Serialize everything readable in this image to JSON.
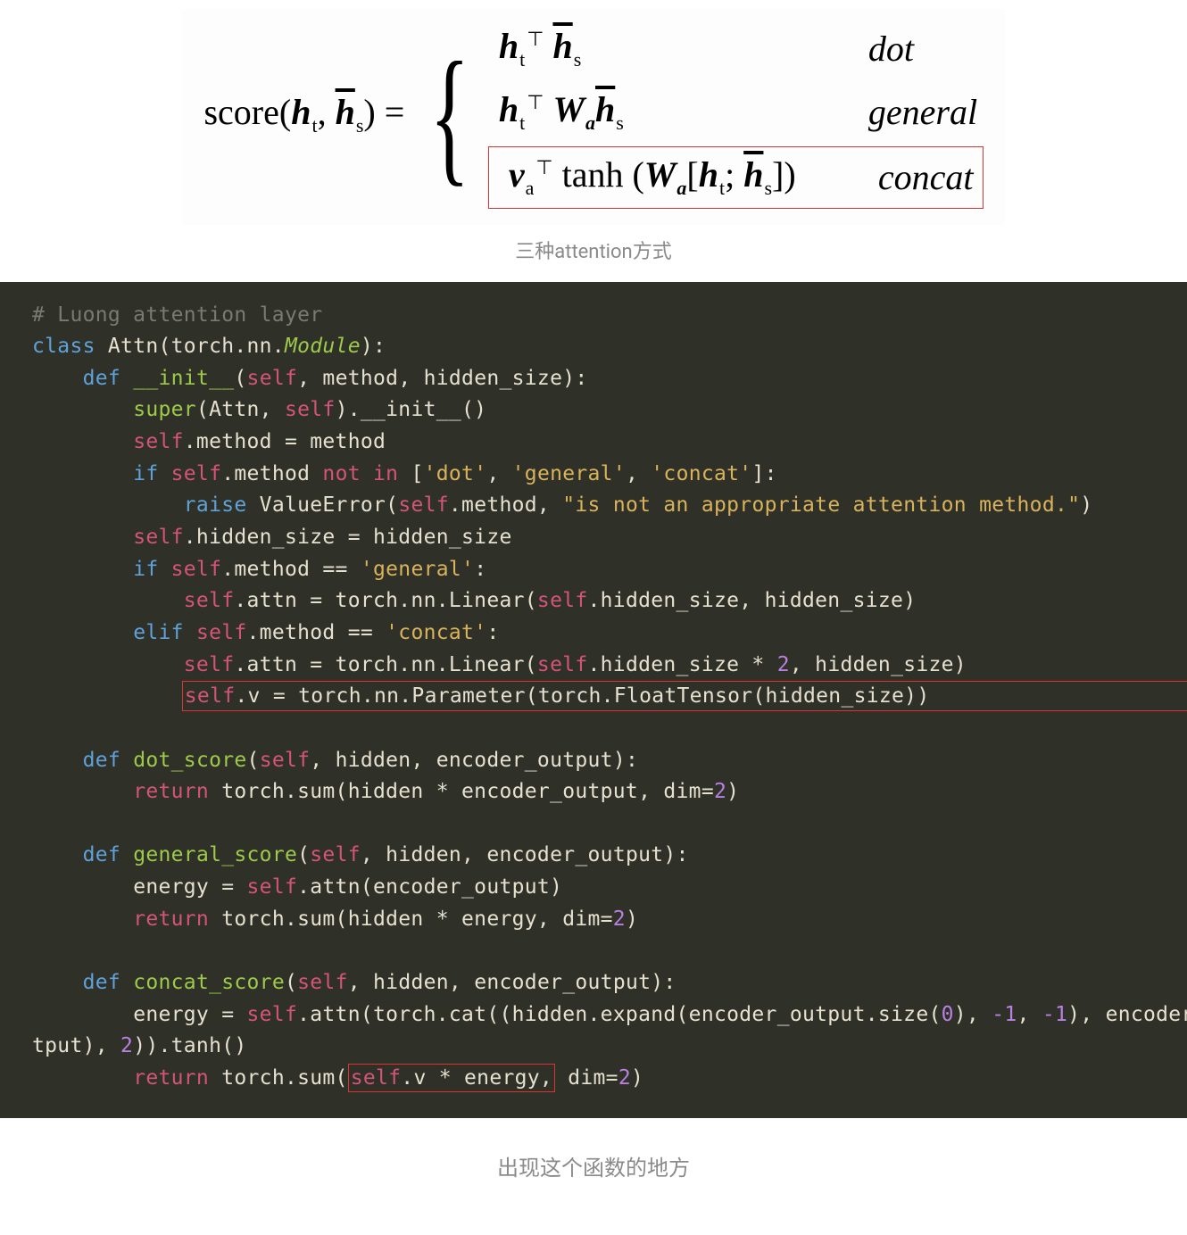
{
  "formula": {
    "lhs": "score(h_t, h̄_s) =",
    "cases": [
      {
        "expr": "h_t^T h̄_s",
        "label": "dot"
      },
      {
        "expr": "h_t^T W_a h̄_s",
        "label": "general"
      },
      {
        "expr": "v_a^T tanh(W_a [h_t; h̄_s])",
        "label": "concat"
      }
    ]
  },
  "caption_formula": "三种attention方式",
  "code": {
    "l1": "# Luong attention layer",
    "l2a": "class",
    "l2b": " Attn(torch.nn.",
    "l2c": "Module",
    "l2d": "):",
    "l3a": "def",
    "l3b": "__init__",
    "l3c": "self",
    "l3d": ", method, hidden_size):",
    "l4a": "super",
    "l4b": "(Attn, ",
    "l4c": "self",
    "l4d": ").__init__()",
    "l5a": "self",
    "l5b": ".method = method",
    "l6a": "if",
    "l6b": "self",
    "l6c": ".method ",
    "l6d": "not in",
    "l6e": " [",
    "l6f": "'dot'",
    "l6g": ", ",
    "l6h": "'general'",
    "l6i": ", ",
    "l6j": "'concat'",
    "l6k": "]:",
    "l7a": "raise",
    "l7b": " ValueError(",
    "l7c": "self",
    "l7d": ".method, ",
    "l7e": "\"is not an appropriate attention method.\"",
    "l7f": ")",
    "l8a": "self",
    "l8b": ".hidden_size = hidden_size",
    "l9a": "if",
    "l9b": "self",
    "l9c": ".method == ",
    "l9d": "'general'",
    "l9e": ":",
    "l10a": "self",
    "l10b": ".attn = torch.nn.Linear(",
    "l10c": "self",
    "l10d": ".hidden_size, hidden_size)",
    "l11a": "elif",
    "l11b": "self",
    "l11c": ".method == ",
    "l11d": "'concat'",
    "l11e": ":",
    "l12a": "self",
    "l12b": ".attn = torch.nn.Linear(",
    "l12c": "self",
    "l12d": ".hidden_size * ",
    "l12e": "2",
    "l12f": ", hidden_size)",
    "l13a": "self",
    "l13b": ".v = torch.nn.Parameter(torch.FloatTensor(hidden_size))",
    "l14a": "def",
    "l14b": "dot_score",
    "l14c": "self",
    "l14d": ", hidden, encoder_output):",
    "l15a": "return",
    "l15b": " torch.sum(hidden * encoder_output, dim=",
    "l15c": "2",
    "l15d": ")",
    "l16a": "def",
    "l16b": "general_score",
    "l16c": "self",
    "l16d": ", hidden, encoder_output):",
    "l17a": "energy = ",
    "l17b": "self",
    "l17c": ".attn(encoder_output)",
    "l18a": "return",
    "l18b": " torch.sum(hidden * energy, dim=",
    "l18c": "2",
    "l18d": ")",
    "l19a": "def",
    "l19b": "concat_score",
    "l19c": "self",
    "l19d": ", hidden, encoder_output):",
    "l20a": "energy = ",
    "l20b": "self",
    "l20c": ".attn(torch.cat((hidden.expand(encoder_output.size(",
    "l20d": "0",
    "l20e": "), ",
    "l20f": "-1",
    "l20g": ", ",
    "l20h": "-1",
    "l20i": "), encoder_o",
    "l20j": "tput), ",
    "l20k": "2",
    "l20l": ")).tanh()",
    "l21a": "return",
    "l21b": " torch.sum(",
    "l21c": "self",
    "l21d": ".v * energy,",
    "l21e": " dim=",
    "l21f": "2",
    "l21g": ")"
  },
  "caption_code": "出现这个函数的地方"
}
